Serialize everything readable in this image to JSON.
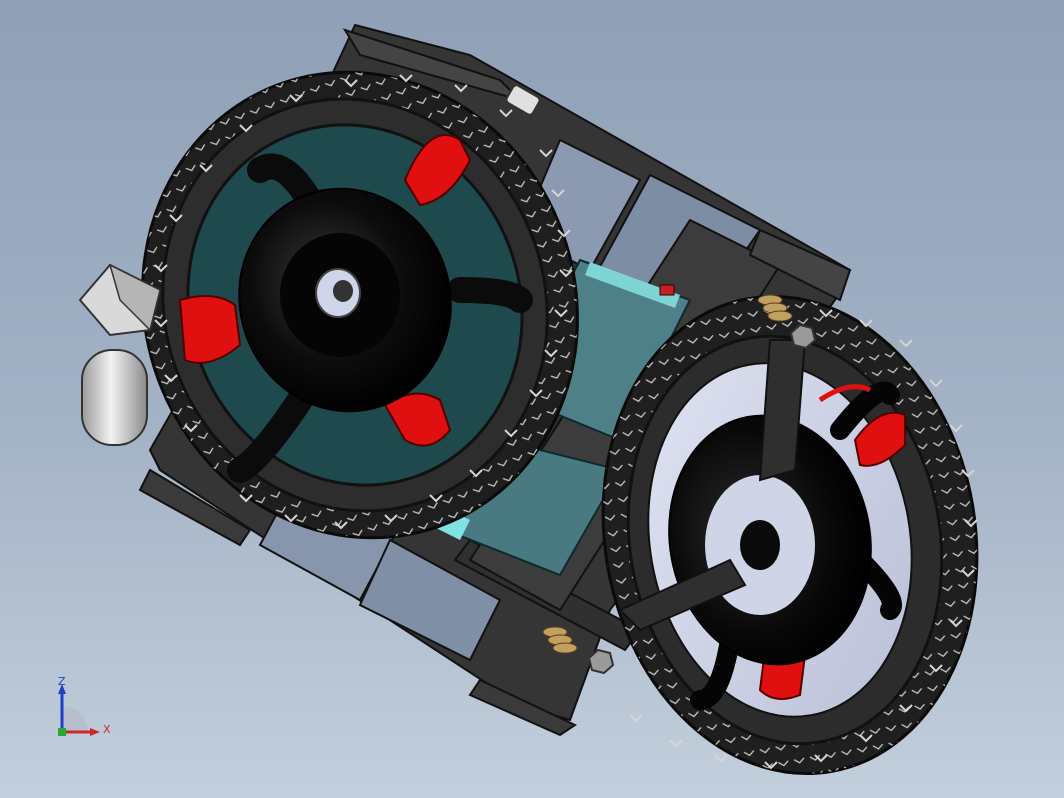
{
  "viewport": {
    "background_top": "#8fa0b6",
    "background_bottom": "#c3cfdc"
  },
  "triad": {
    "z_label": "Z",
    "x_label": "X",
    "z_color": "#1f3fc4",
    "x_color": "#cc2a2a",
    "y_color": "#22aa33"
  },
  "model": {
    "frame_color": "#3a3a3a",
    "tire_color": "#2b2b2b",
    "spoke_color": "#e01010",
    "motor_color": "#3fc7c0",
    "battery_color": "#4d7f86",
    "hub_color": "#050505"
  }
}
